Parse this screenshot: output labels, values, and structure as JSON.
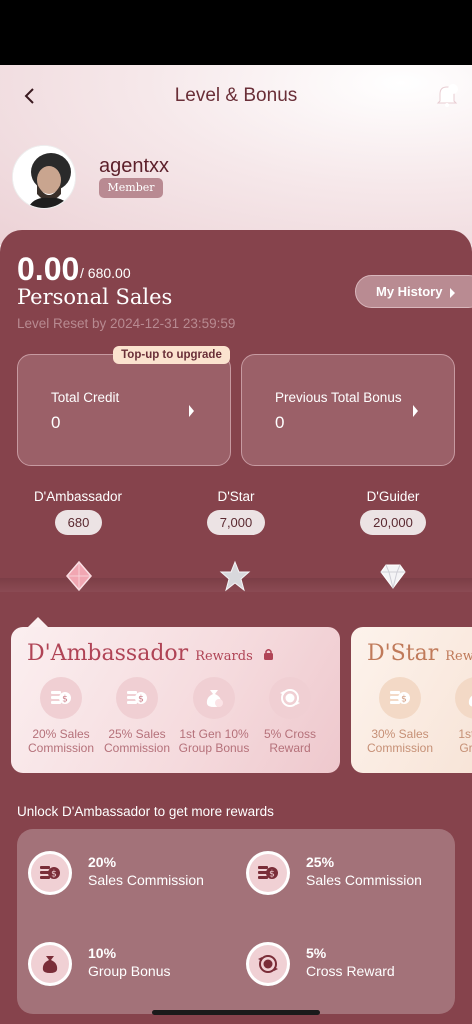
{
  "header": {
    "title": "Level & Bonus"
  },
  "user": {
    "name": "agentxx",
    "badge": "Member"
  },
  "sales": {
    "value": "0.00",
    "target": "/ 680.00",
    "label": "Personal Sales",
    "reset": "Level Reset by 2024-12-31 23:59:59",
    "history_button": "My History"
  },
  "cards": {
    "upgrade_badge": "Top-up to upgrade",
    "credit": {
      "label": "Total Credit",
      "value": "0"
    },
    "bonus": {
      "label": "Previous Total Bonus",
      "value": "0"
    }
  },
  "tiers": [
    {
      "name": "D'Ambassador",
      "threshold": "680",
      "icon": "pink-diamond-icon"
    },
    {
      "name": "D'Star",
      "threshold": "7,000",
      "icon": "silver-star-icon"
    },
    {
      "name": "D'Guider",
      "threshold": "20,000",
      "icon": "white-diamond-icon"
    }
  ],
  "reward_cards": [
    {
      "title": "D'Ambassador",
      "subtitle": "Rewards",
      "items": [
        {
          "line1": "20% Sales",
          "line2": "Commission",
          "icon": "coins-dollar-icon"
        },
        {
          "line1": "25% Sales",
          "line2": "Commission",
          "icon": "coins-dollar-icon"
        },
        {
          "line1": "1st Gen 10%",
          "line2": "Group Bonus",
          "icon": "money-bag-icon"
        },
        {
          "line1": "5% Cross",
          "line2": "Reward",
          "icon": "cross-reward-icon"
        }
      ]
    },
    {
      "title": "D'Star",
      "subtitle": "Rewards",
      "items": [
        {
          "line1": "30% Sales",
          "line2": "Commission",
          "icon": "coins-dollar-icon"
        },
        {
          "line1": "1st Ge",
          "line2": "Group",
          "icon": "money-bag-icon"
        }
      ]
    }
  ],
  "unlock": {
    "text": "Unlock D'Ambassador to get more rewards",
    "items": [
      {
        "pct": "20%",
        "name": "Sales Commission",
        "icon": "coins-dollar-icon"
      },
      {
        "pct": "25%",
        "name": "Sales Commission",
        "icon": "coins-dollar-icon"
      },
      {
        "pct": "10%",
        "name": "Group Bonus",
        "icon": "money-bag-icon"
      },
      {
        "pct": "5%",
        "name": "Cross Reward",
        "icon": "cross-reward-icon"
      }
    ]
  },
  "colors": {
    "panel": "#86434c",
    "accent": "#b04456",
    "badge": "#fbe3cf"
  }
}
